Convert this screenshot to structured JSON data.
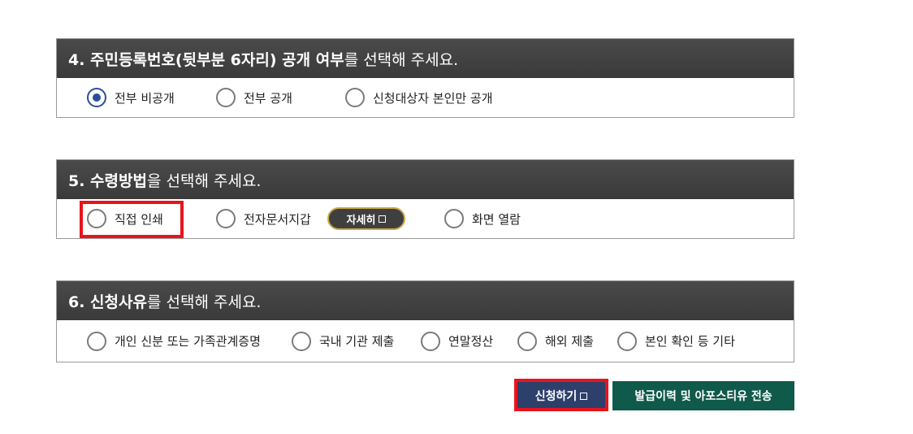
{
  "sections": [
    {
      "head_bold": "4. 주민등록번호(뒷부분 6자리) 공개 여부",
      "head_rest": "를 선택해 주세요.",
      "options": [
        "전부 비공개",
        "전부 공개",
        "신청대상자 본인만 공개"
      ],
      "selected": "전부 비공개"
    },
    {
      "head_bold": "5. 수령방법",
      "head_rest": "을 선택해 주세요.",
      "options": [
        "직접 인쇄",
        "전자문서지갑",
        "화면 열람"
      ],
      "detail_label": "자세히",
      "highlight_color": "#e8141b"
    },
    {
      "head_bold": "6. 신청사유",
      "head_rest": "를 선택해 주세요.",
      "options": [
        "개인 신분 또는 가족관계증명",
        "국내 기관 제출",
        "연말정산",
        "해외 제출",
        "본인 확인 등 기타"
      ]
    }
  ],
  "buttons": {
    "apply_label": "신청하기",
    "send_label": "발급이력 및 아포스티유 전송"
  },
  "colors": {
    "header_bg": "#3f3f3f",
    "radio_selected": "#2a4c9c",
    "apply_bg": "#2d3f6b",
    "send_bg": "#0f5a4a",
    "highlight": "#e8141b"
  }
}
